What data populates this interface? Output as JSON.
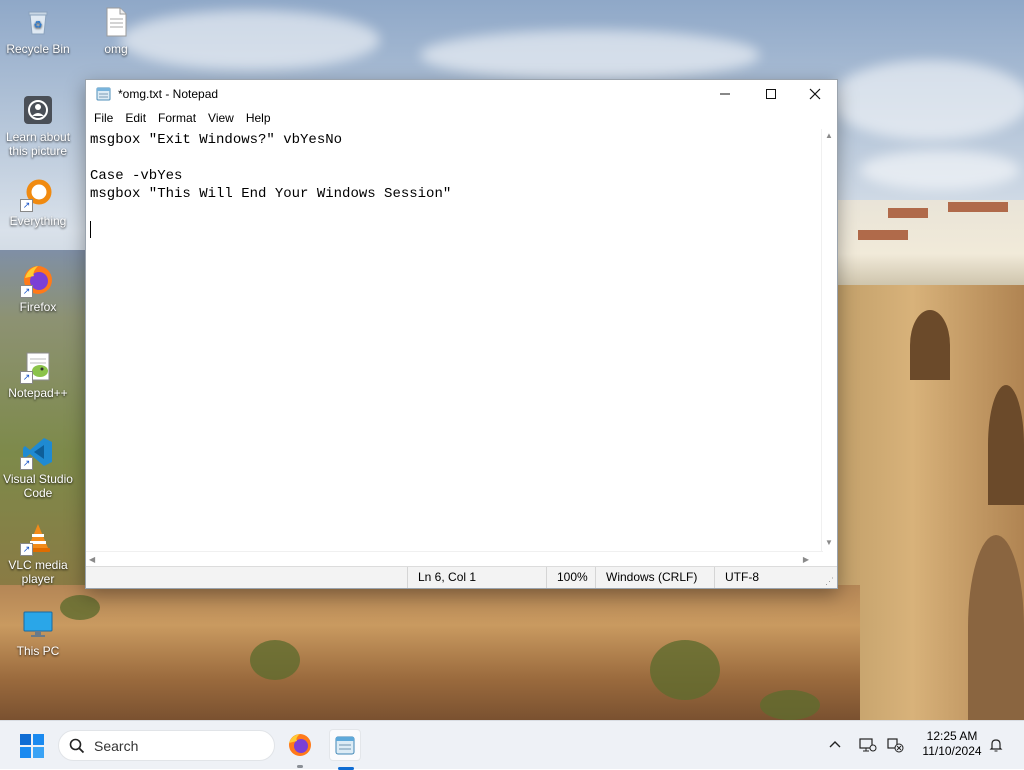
{
  "desktop": {
    "icons": [
      {
        "label": "Recycle Bin",
        "icon": "recycle-bin-icon"
      },
      {
        "label": "omg",
        "icon": "text-file-icon"
      },
      {
        "label": "Learn about this picture",
        "icon": "learn-picture-icon"
      },
      {
        "label": "Everything",
        "icon": "everything-search-icon"
      },
      {
        "label": "Firefox",
        "icon": "firefox-icon"
      },
      {
        "label": "Notepad++",
        "icon": "notepad-plus-plus-icon"
      },
      {
        "label": "Visual Studio Code",
        "icon": "vscode-icon"
      },
      {
        "label": "VLC media player",
        "icon": "vlc-icon"
      },
      {
        "label": "This PC",
        "icon": "this-pc-icon"
      }
    ]
  },
  "notepad": {
    "title": "*omg.txt - Notepad",
    "menu": [
      "File",
      "Edit",
      "Format",
      "View",
      "Help"
    ],
    "lines": [
      "msgbox \"Exit Windows?\" vbYesNo",
      "",
      "Case -vbYes",
      "msgbox \"This Will End Your Windows Session\"",
      ""
    ],
    "status": {
      "position": "Ln 6, Col 1",
      "zoom": "100%",
      "line_ending": "Windows (CRLF)",
      "encoding": "UTF-8"
    }
  },
  "taskbar": {
    "search_placeholder": "Search",
    "apps": [
      "firefox-icon",
      "notepad-icon"
    ],
    "time": "12:25 AM",
    "date": "11/10/2024"
  }
}
